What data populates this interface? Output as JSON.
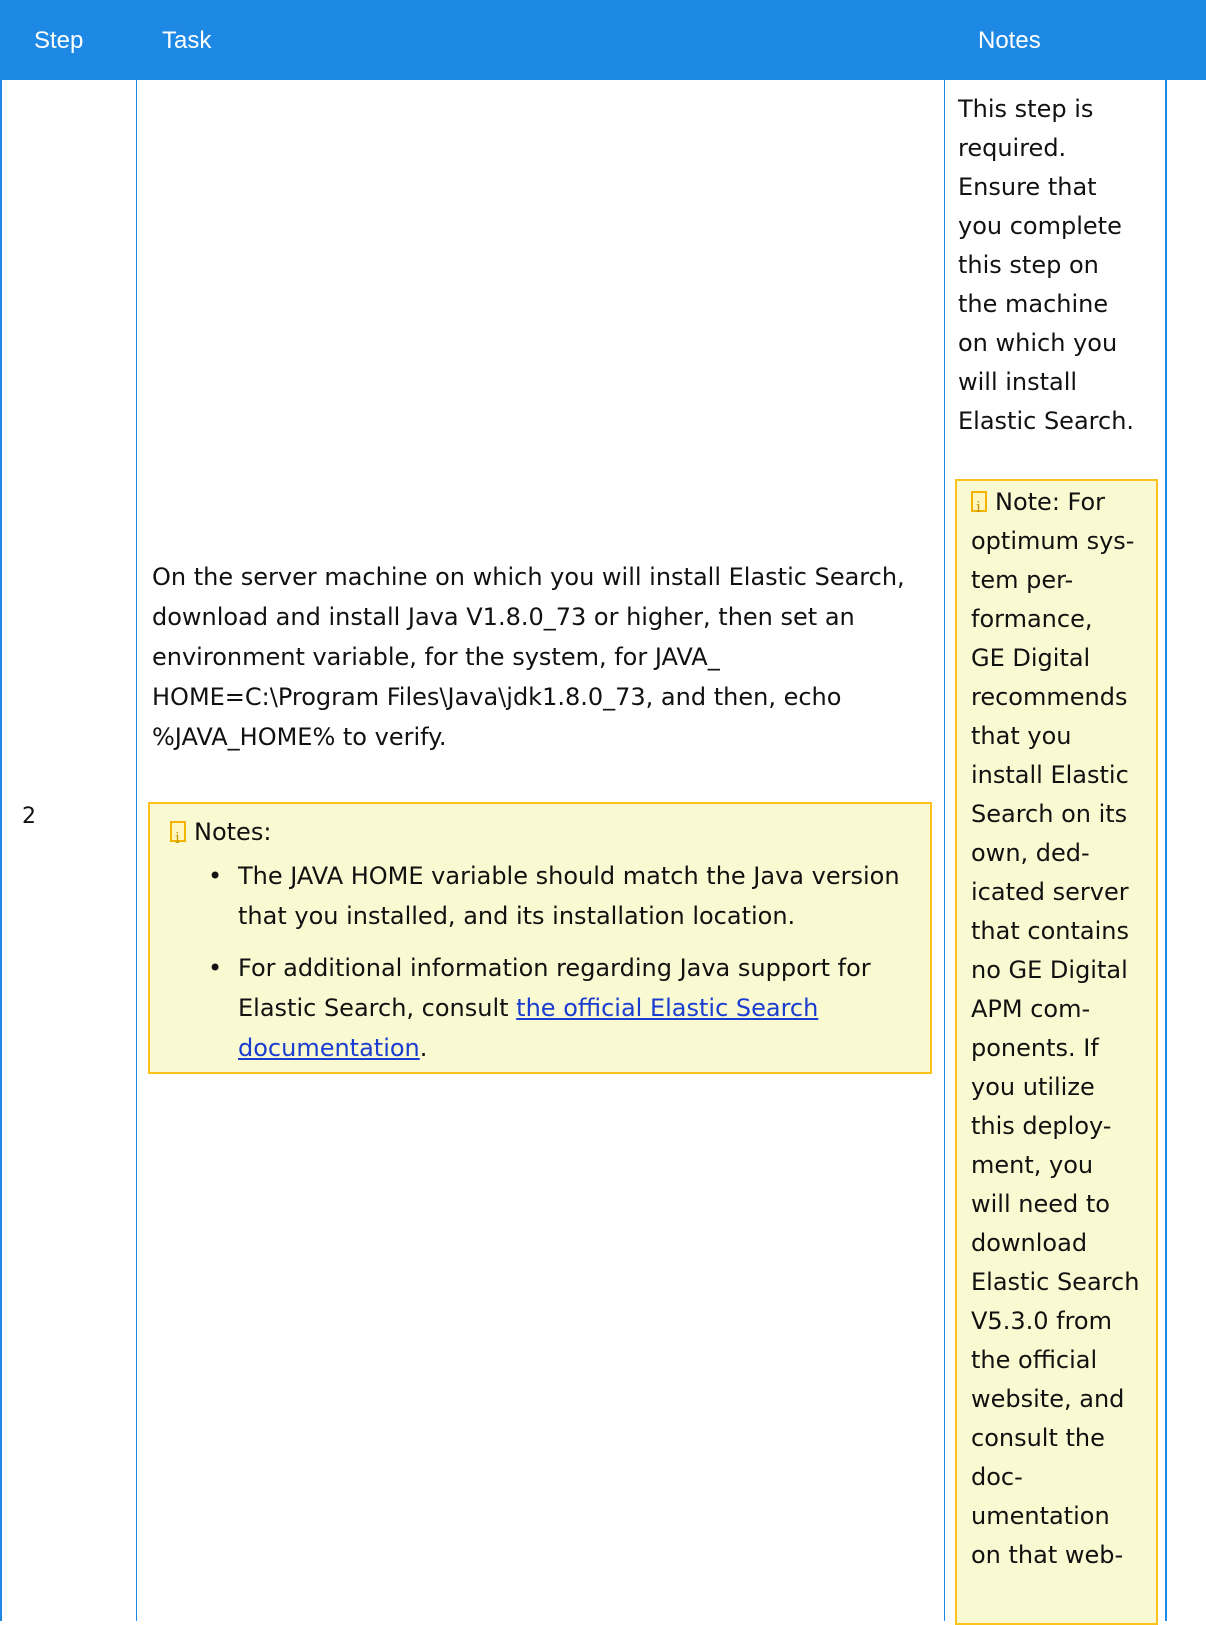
{
  "header": {
    "step": "Step",
    "task": "Task",
    "notes": "Notes"
  },
  "row": {
    "step": "2",
    "task_text": "On the server machine on which you will install Elastic Search, download and install Java V1.8.0_73 or higher, then set an environment variable, for the system, for JAVA_ HOME=C:\\Program Files\\Java\\jdk1.8.0_73, and then, echo %JAVA_HOME% to verify.",
    "notes_box": {
      "title": "Notes:",
      "bullet1": "The JAVA HOME variable should match the Java version that you installed, and its installation location.",
      "bullet2_prefix": "For additional information regarding Java support for Elastic Search, consult ",
      "bullet2_link": "the official Elastic Search documentation",
      "bullet2_suffix": "."
    },
    "notes_col": {
      "text_lines": [
        "This step is",
        "required.",
        "Ensure that",
        "you complete",
        "this step on",
        "the machine",
        "on which you",
        "will install",
        "Elastic Search."
      ],
      "note_label": "Note:",
      "note_lines": [
        "For",
        "optimum sys-",
        "tem per-",
        "formance,",
        "GE Digital",
        "recommends",
        "that you",
        "install Elastic",
        "Search on its",
        "own, ded-",
        "icated server",
        "that contains",
        "no GE Digital",
        "APM com-",
        "ponents. If",
        "you utilize",
        "this deploy-",
        "ment, you",
        "will need to",
        "download",
        "Elastic Search",
        "V5.3.0 from",
        "the official",
        "website, and",
        "consult the",
        "doc-",
        "umentation",
        "on that web-"
      ]
    }
  },
  "colors": {
    "header_bg": "#1e88e5",
    "note_bg": "#fafad2",
    "note_border": "#fcc21b"
  },
  "icons": {
    "note": "note-info-icon"
  }
}
